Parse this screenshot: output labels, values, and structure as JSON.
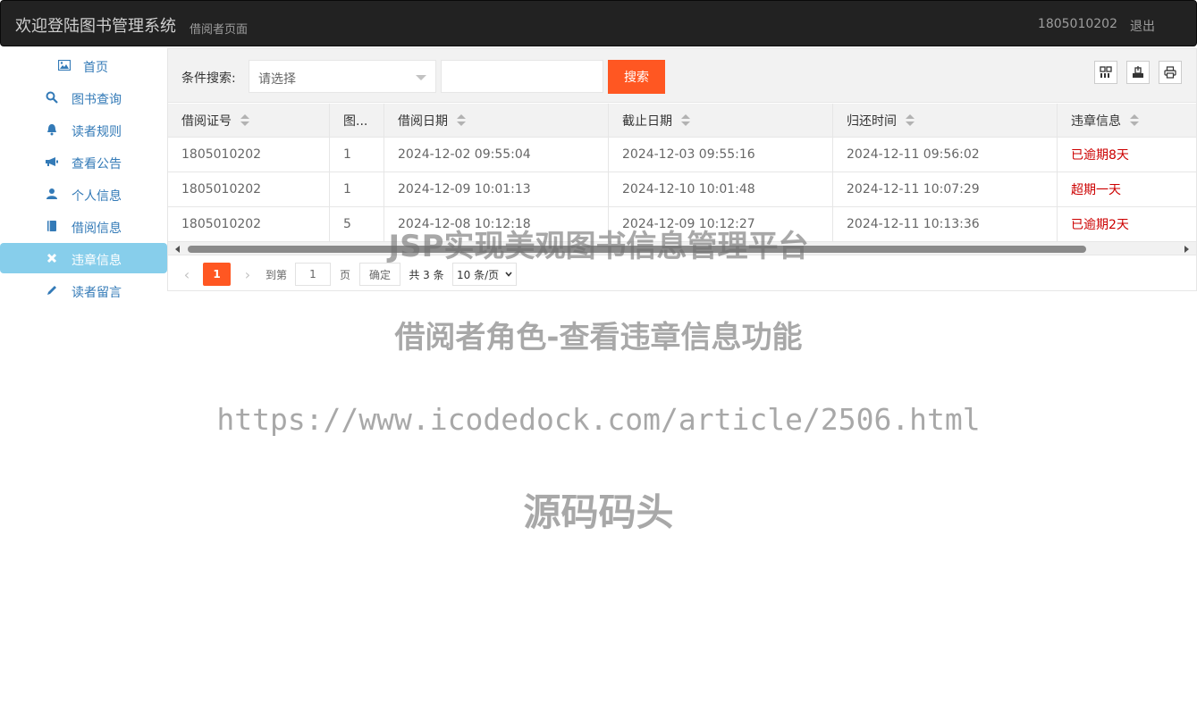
{
  "header": {
    "title": "欢迎登陆图书管理系统",
    "subtitle": "借阅者页面",
    "user": "1805010202",
    "logout": "退出"
  },
  "sidebar": {
    "items": [
      {
        "label": "首页",
        "icon": "picture-icon"
      },
      {
        "label": "图书查询",
        "icon": "search-icon"
      },
      {
        "label": "读者规则",
        "icon": "bell-icon"
      },
      {
        "label": "查看公告",
        "icon": "bullhorn-icon"
      },
      {
        "label": "个人信息",
        "icon": "user-icon"
      },
      {
        "label": "借阅信息",
        "icon": "book-icon"
      },
      {
        "label": "违章信息",
        "icon": "close-icon"
      },
      {
        "label": "读者留言",
        "icon": "pencil-icon"
      }
    ],
    "active": "违章信息"
  },
  "toolbar": {
    "search_label": "条件搜索:",
    "select_value": "请选择",
    "keyword_value": "",
    "search_button": "搜索"
  },
  "table": {
    "columns": [
      "借阅证号",
      "图...",
      "借阅日期",
      "截止日期",
      "归还时间",
      "违章信息"
    ],
    "rows": [
      [
        "1805010202",
        "1",
        "2024-12-02 09:55:04",
        "2024-12-03 09:55:16",
        "2024-12-11 09:56:02",
        "已逾期8天"
      ],
      [
        "1805010202",
        "1",
        "2024-12-09 10:01:13",
        "2024-12-10 10:01:48",
        "2024-12-11 10:07:29",
        "超期一天"
      ],
      [
        "1805010202",
        "5",
        "2024-12-08 10:12:18",
        "2024-12-09 10:12:27",
        "2024-12-11 10:13:36",
        "已逾期2天"
      ]
    ]
  },
  "pager": {
    "current_page": "1",
    "goto_label": "到第",
    "goto_value": "1",
    "page_unit": "页",
    "confirm": "确定",
    "total": "共 3 条",
    "page_size": "10 条/页"
  },
  "watermark": {
    "line1": "JSP实现美观图书信息管理平台",
    "line2": "借阅者角色-查看违章信息功能",
    "line3": "https://www.icodedock.com/article/2506.html",
    "line4": "源码码头"
  },
  "colors": {
    "accent": "#ff5722",
    "active_nav": "#87ceeb",
    "violation_text": "#cc0000",
    "topbar": "#222222"
  }
}
